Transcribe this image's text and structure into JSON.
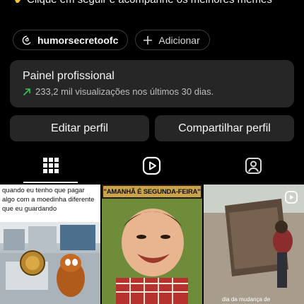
{
  "bio": {
    "text": "Clique em seguir e acompanhe os melhores memes"
  },
  "chips": {
    "threads_handle": "humorsecretoofc",
    "add_label": "Adicionar"
  },
  "professional_panel": {
    "title": "Painel profissional",
    "stat": "233,2 mil visualizações nos últimos 30 dias."
  },
  "actions": {
    "edit_label": "Editar perfil",
    "share_label": "Compartilhar perfil"
  },
  "tabs": [
    {
      "icon": "grid-icon",
      "selected": true
    },
    {
      "icon": "reels-icon",
      "selected": false
    },
    {
      "icon": "tagged-icon",
      "selected": false
    }
  ],
  "posts": [
    {
      "caption": "quando eu tenho que pagar algo com a moedinha diferente que eu guardando"
    },
    {
      "caption": "\"AMANHÃ É SEGUNDA-FEIRA\""
    },
    {
      "caption": "dia da mudança de",
      "is_video": true
    }
  ],
  "colors": {
    "background": "#000000",
    "card": "#262626",
    "accent_green": "#34c759"
  }
}
